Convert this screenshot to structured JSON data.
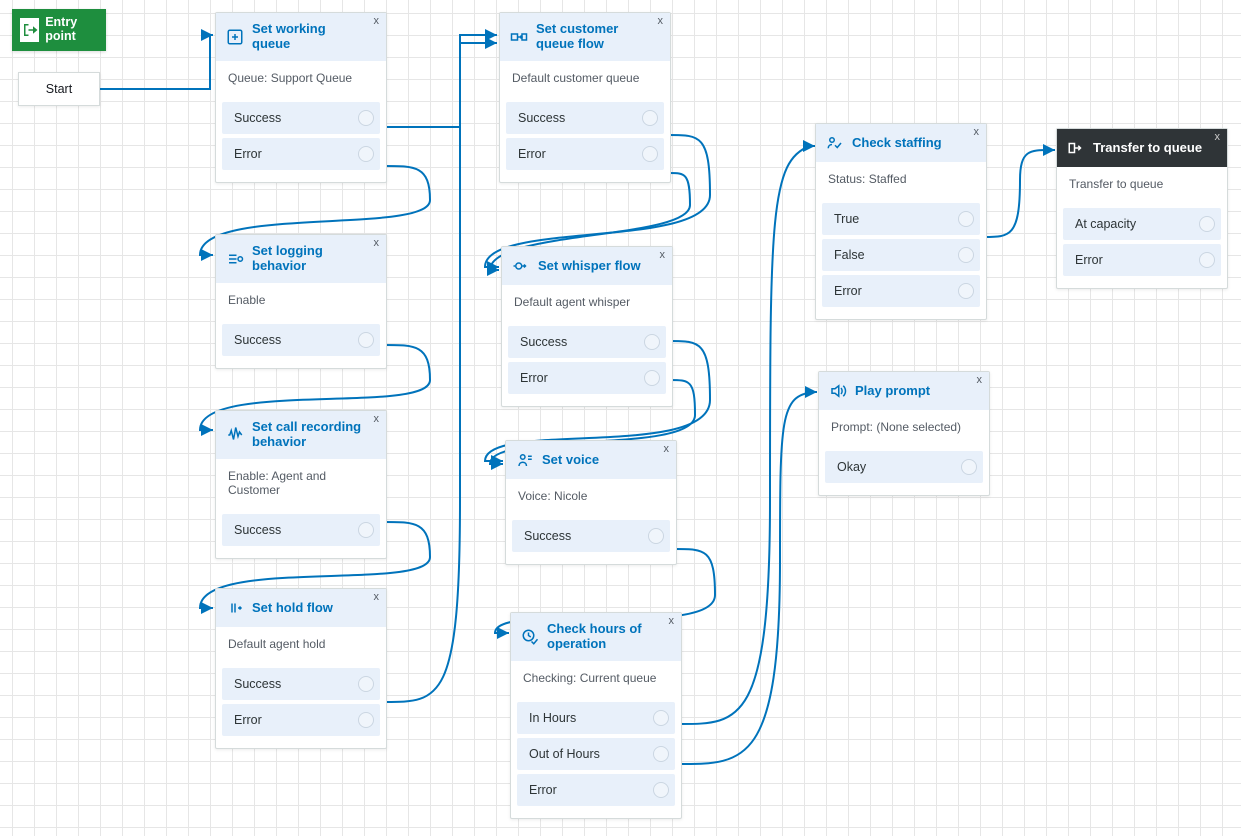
{
  "entry": {
    "label": "Entry point"
  },
  "start": {
    "label": "Start"
  },
  "nodes": {
    "setQueue": {
      "title": "Set working queue",
      "desc": "Queue: Support Queue",
      "outs": [
        "Success",
        "Error"
      ]
    },
    "setLogging": {
      "title": "Set logging behavior",
      "desc": "Enable",
      "outs": [
        "Success"
      ]
    },
    "setRecording": {
      "title": "Set call recording behavior",
      "desc": "Enable: Agent and Customer",
      "outs": [
        "Success"
      ]
    },
    "setHold": {
      "title": "Set hold flow",
      "desc": "Default agent hold",
      "outs": [
        "Success",
        "Error"
      ]
    },
    "setCustQueue": {
      "title": "Set customer queue flow",
      "desc": "Default customer queue",
      "outs": [
        "Success",
        "Error"
      ]
    },
    "setWhisper": {
      "title": "Set whisper flow",
      "desc": "Default agent whisper",
      "outs": [
        "Success",
        "Error"
      ]
    },
    "setVoice": {
      "title": "Set voice",
      "desc": "Voice: Nicole",
      "outs": [
        "Success"
      ]
    },
    "checkHours": {
      "title": "Check hours of operation",
      "desc": "Checking: Current queue",
      "outs": [
        "In Hours",
        "Out of Hours",
        "Error"
      ]
    },
    "checkStaffing": {
      "title": "Check staffing",
      "desc": "Status: Staffed",
      "outs": [
        "True",
        "False",
        "Error"
      ]
    },
    "playPrompt": {
      "title": "Play prompt",
      "desc": "Prompt: (None selected)",
      "outs": [
        "Okay"
      ]
    },
    "transfer": {
      "title": "Transfer to queue",
      "desc": "Transfer to queue",
      "outs": [
        "At capacity",
        "Error"
      ]
    }
  }
}
